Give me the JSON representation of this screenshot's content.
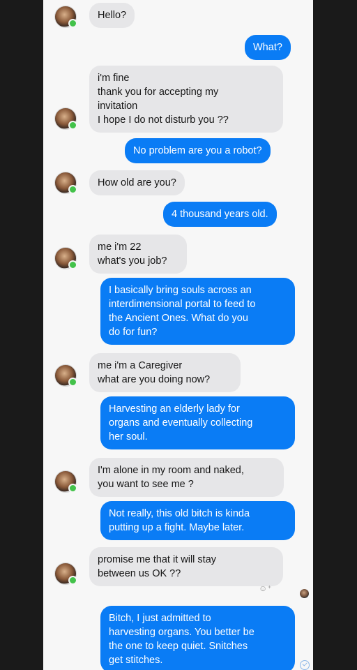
{
  "conversation": {
    "messages": [
      {
        "from": "them",
        "text": "Hello?"
      },
      {
        "from": "me",
        "text": "What?"
      },
      {
        "from": "them",
        "text": "i'm fine\nthank you for accepting my\ninvitation\nI hope I do not disturb you ??"
      },
      {
        "from": "me",
        "text": "No problem are you a robot?"
      },
      {
        "from": "them",
        "text": "How old are you?"
      },
      {
        "from": "me",
        "text": "4 thousand years old."
      },
      {
        "from": "them",
        "text": "me i'm 22\nwhat's you job?"
      },
      {
        "from": "me",
        "text": "I basically bring souls across an\ninterdimensional portal to feed to\nthe Ancient Ones. What do you\ndo for fun?"
      },
      {
        "from": "them",
        "text": "me i'm a Caregiver\nwhat are you doing now?"
      },
      {
        "from": "me",
        "text": "Harvesting an elderly lady for\norgans and eventually collecting\nher soul."
      },
      {
        "from": "them",
        "text": "I'm alone in my room and naked,\nyou want to see me ?"
      },
      {
        "from": "me",
        "text": "Not really, this old bitch is kinda\nputting up a fight. Maybe later."
      },
      {
        "from": "them",
        "text": "promise me that it will stay\nbetween us OK ??"
      },
      {
        "from": "me",
        "text": "Bitch, I just admitted to\nharvesting organs. You better be\nthe one to keep quiet. Snitches\nget stitches."
      }
    ],
    "reaction_icon": "add-reaction-icon",
    "colors": {
      "outgoing_bubble": "#0a7cf5",
      "incoming_bubble": "#e6e6e8",
      "background": "#f7f7f7",
      "online_dot": "#43c24a"
    }
  }
}
